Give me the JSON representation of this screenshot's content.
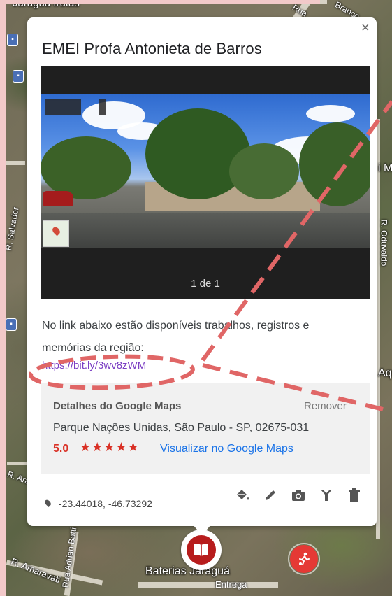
{
  "map": {
    "labels": {
      "top_left": "Jaraguá frutas",
      "top_right": "Rua",
      "top_right2": "Branco",
      "left_vertical": "R. Salvador",
      "right_mid": "i M",
      "right_vertical": "R. Oduvaldo",
      "right_aq": "Aqu",
      "bottom_left1": "R. Ara",
      "bottom_left2": "R. Amaravati",
      "bottom_vertical": "Rua Adrian Batti",
      "bottom_place": "Baterias Jaraguá",
      "bottom_place2": "Entrega"
    }
  },
  "popup": {
    "close": "×",
    "title": "EMEI Profa Antonieta de Barros",
    "photo_counter": "1 de 1",
    "description": "No link abaixo estão disponíveis trabalhos, registros e memórias da região:",
    "link": "https://bit.ly/3wv8zWM",
    "google_maps": {
      "heading": "Detalhes do Google Maps",
      "remove": "Remover",
      "address": "Parque Nações Unidas, São Paulo - SP, 02675-031",
      "rating": "5.0",
      "stars": "★★★★★",
      "view_link": "Visualizar no Google Maps"
    },
    "coordinates": "-23.44018, -46.73292",
    "toolbar": {
      "icons": [
        "paint-bucket-icon",
        "pencil-icon",
        "camera-icon",
        "filter-icon",
        "trash-icon"
      ]
    }
  },
  "colors": {
    "accent_red": "#d93025",
    "link_purple": "#7b3fc4",
    "link_blue": "#1a73e8",
    "annotation": "#e06666"
  }
}
